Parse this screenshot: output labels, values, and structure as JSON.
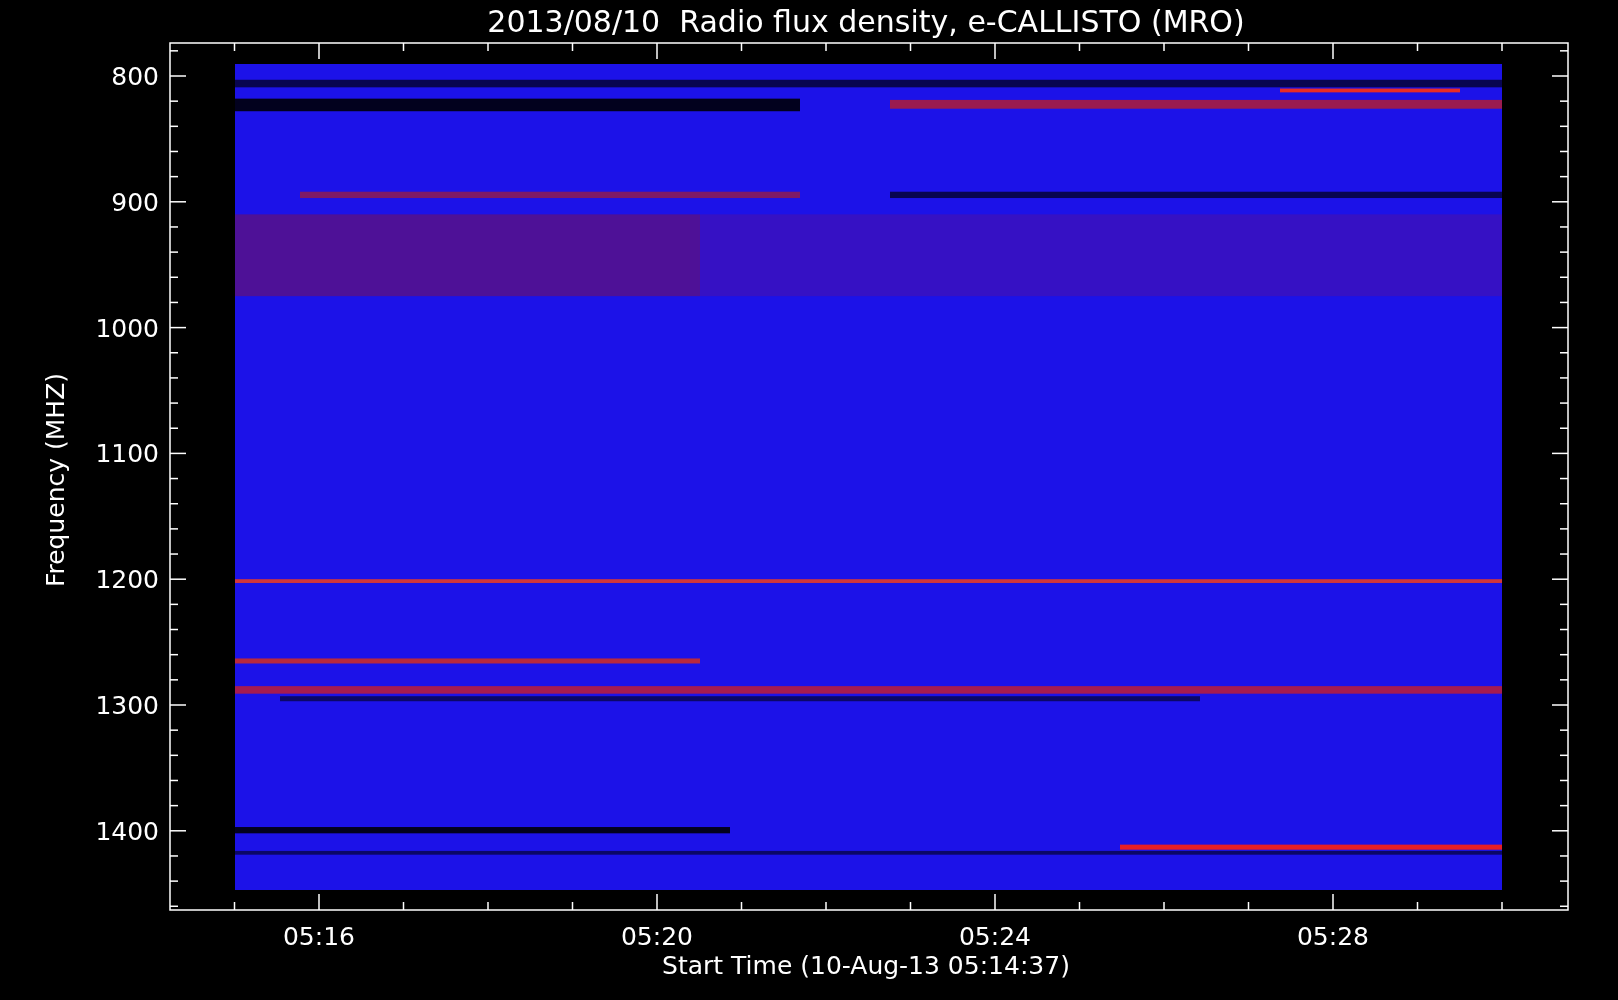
{
  "title": "2013/08/10  Radio flux density, e-CALLISTO (MRO)",
  "y_axis": {
    "label": "Frequency (MHZ)",
    "ticks": [
      "800",
      "900",
      "1000",
      "1100",
      "1200",
      "1300",
      "1400"
    ]
  },
  "x_axis": {
    "label": "Start Time (10-Aug-13 05:14:37)",
    "ticks": [
      "05:16",
      "05:20",
      "05:24",
      "05:28"
    ]
  }
}
